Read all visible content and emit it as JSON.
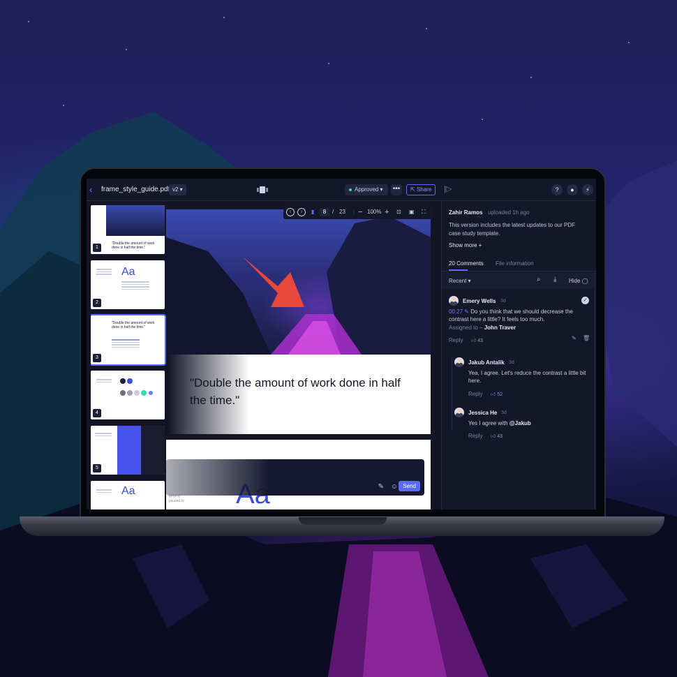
{
  "app": {
    "filename": "frame_style_guide.pdf",
    "version": "v2",
    "status": "Approved",
    "share_label": "Share",
    "more_label": "•••"
  },
  "viewer": {
    "current_page": "8",
    "page_separator": "/",
    "total_pages": "23",
    "zoom": "100%",
    "page1_quote": "\"Double the amount of work done in half the time.\"",
    "page2_heading": "Aa",
    "page2_fragment": "gnlying\npsused to"
  },
  "thumbnails": [
    {
      "number": "1",
      "quote": "\"Double the amount of work done in half the time.\""
    },
    {
      "number": "2",
      "heading": "Aa"
    },
    {
      "number": "3",
      "quote": "\"Double the amount of work done in half the time.\""
    },
    {
      "number": "4"
    },
    {
      "number": "5"
    },
    {
      "number": "",
      "heading": "Aa"
    }
  ],
  "composer": {
    "send_label": "Send"
  },
  "panel": {
    "author": "Zahir Ramos",
    "uploaded": "uploaded 1h ago",
    "description": "This version includes the latest updates to our PDF case study template.",
    "show_more": "Show more +",
    "tabs": [
      {
        "label": "20 Comments",
        "active": true
      },
      {
        "label": "File information",
        "active": false
      }
    ],
    "filter": {
      "sort": "Recent ▾",
      "hide_label": "Hide"
    },
    "comments": [
      {
        "name": "Emery Wells",
        "time": "3d",
        "timestamp": "00:27",
        "body": "Do you think that we should decrease the contrast here a little? It feels too much.",
        "assigned_prefix": "Assigned to –",
        "assignee": "John Traver",
        "reply_label": "Reply",
        "likes": "43"
      },
      {
        "name": "Jakub Antalik",
        "time": "3d",
        "body": "Yea, I agree. Let's reduce the contrast a little bit here.",
        "reply_label": "Reply",
        "likes": "52"
      },
      {
        "name": "Jessica He",
        "time": "3d",
        "body_prefix": "Yes I agree with",
        "mention": "@Jakub",
        "reply_label": "Reply",
        "likes": "43"
      }
    ]
  },
  "colors": {
    "accent": "#5b6bff",
    "approved_dot": "#2ee28d",
    "panel_bg": "#14162a"
  }
}
